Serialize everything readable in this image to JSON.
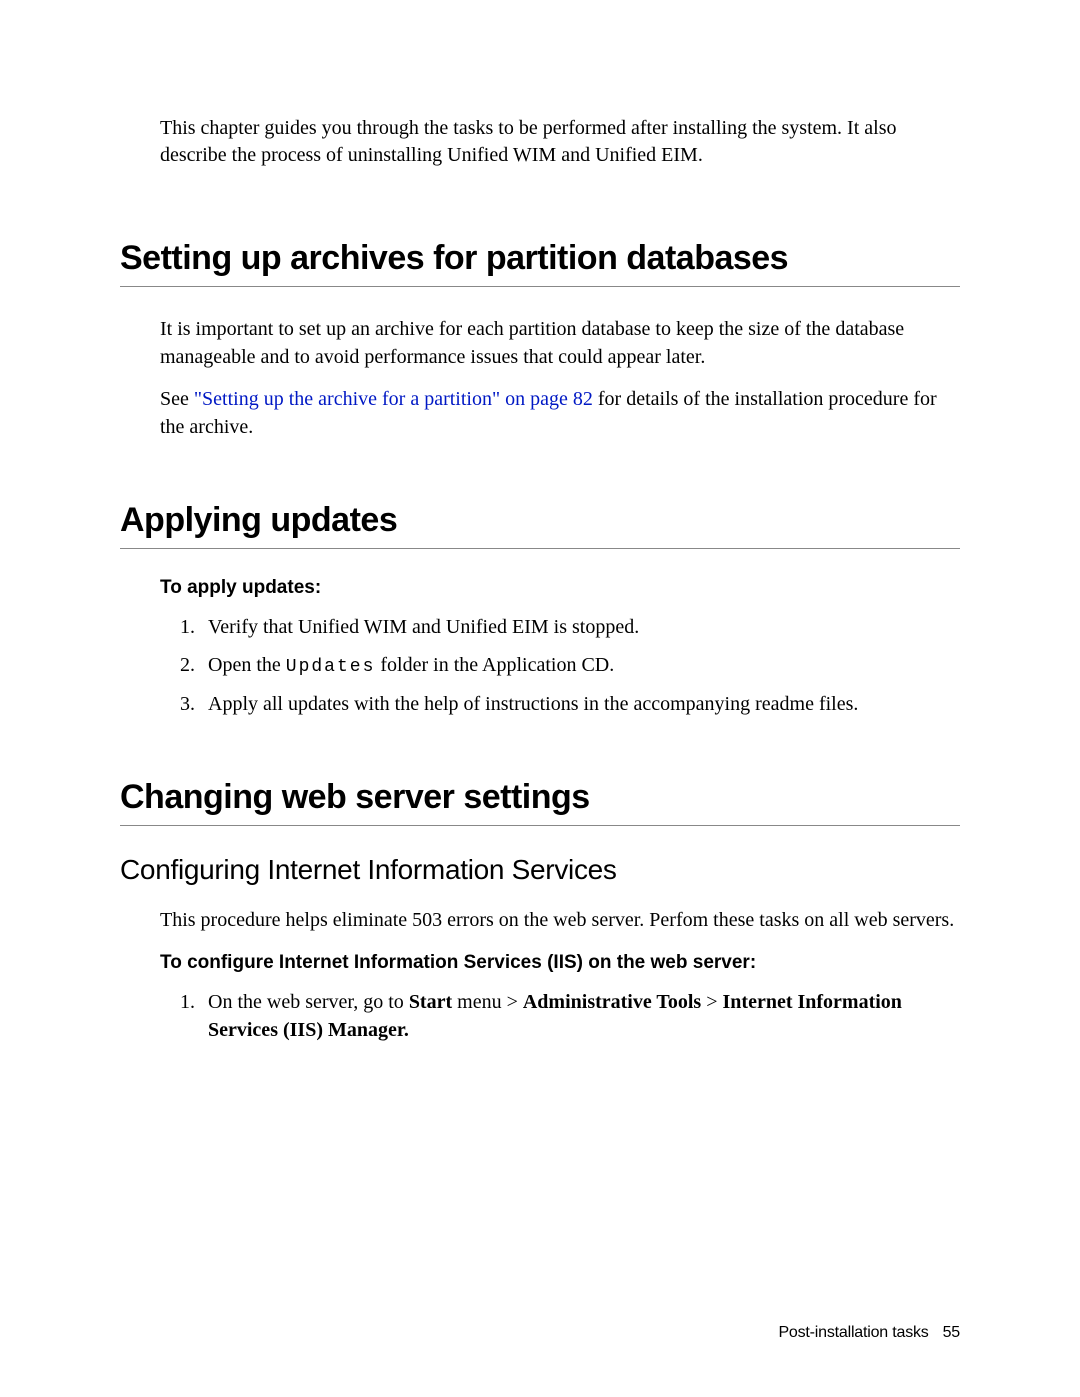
{
  "intro": "This chapter guides you through the tasks to be performed after installing the system. It also describe the process of uninstalling Unified WIM and Unified EIM.",
  "section1": {
    "heading": "Setting up archives for partition databases",
    "p1": "It is important to set up an archive for each partition database to keep the size of the database manageable and to avoid performance issues that could appear later.",
    "p2_pre": "See ",
    "p2_link": "\"Setting up the archive for a partition\" on page 82",
    "p2_post": " for details of the installation procedure for the archive."
  },
  "section2": {
    "heading": "Applying updates",
    "sub": "To apply updates:",
    "li1": "Verify that Unified WIM and Unified EIM is stopped.",
    "li2_pre": "Open the ",
    "li2_mono": "Updates",
    "li2_post": " folder in the Application CD.",
    "li3": "Apply all updates with the help of instructions in the accompanying readme files."
  },
  "section3": {
    "heading": "Changing web server settings",
    "h2": "Configuring Internet Information Services",
    "p1": "This procedure helps eliminate 503 errors on the web server. Perfom these tasks on all web servers.",
    "sub": "To configure Internet Information Services (IIS) on the web server:",
    "li1_pre": "On the web server, go to ",
    "li1_b1": "Start",
    "li1_mid1": " menu > ",
    "li1_b2": "Administrative Tools",
    "li1_mid2": " > ",
    "li1_b3": "Internet Information Services (IIS) Manager."
  },
  "footer": {
    "label": "Post-installation tasks",
    "page": "55"
  }
}
